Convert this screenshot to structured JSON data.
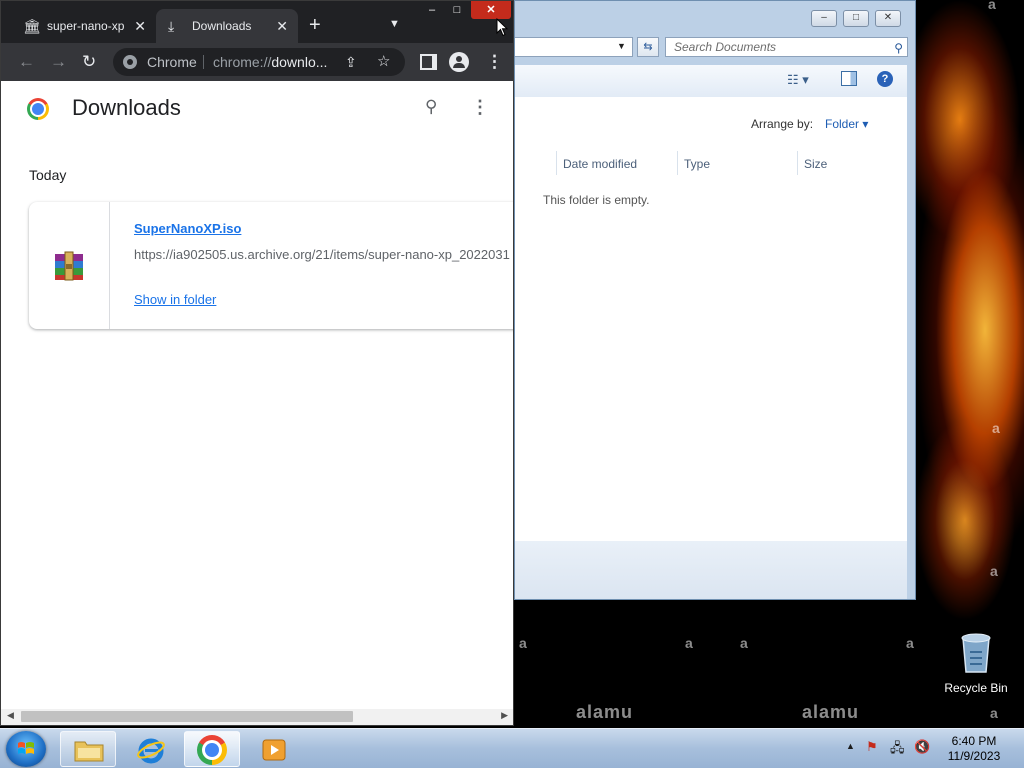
{
  "chrome": {
    "tabs": [
      {
        "label": "super-nano-xp",
        "icon": "institution-icon"
      },
      {
        "label": "Downloads",
        "icon": "download-icon"
      }
    ],
    "omnibox": {
      "site_label": "Chrome",
      "url_prefix": "chrome://",
      "url_rest": "downlo..."
    },
    "downloads": {
      "title": "Downloads",
      "section": "Today",
      "items": [
        {
          "file_name": "SuperNanoXP.iso",
          "url": "https://ia902505.us.archive.org/21/items/super-nano-xp_2022031",
          "action": "Show in folder",
          "icon": "winrar-archive-icon"
        }
      ]
    }
  },
  "explorer": {
    "search_placeholder": "Search Documents",
    "arrange_label": "Arrange by:",
    "arrange_value": "Folder",
    "columns": [
      "Date modified",
      "Type",
      "Size"
    ],
    "empty_message": "This folder is empty."
  },
  "desktop": {
    "recycle_bin_label": "Recycle Bin",
    "watermark_text": "a",
    "watermark_brand": "alamu"
  },
  "taskbar": {
    "time": "6:40 PM",
    "date": "11/9/2023"
  },
  "colors": {
    "chrome_tabstrip": "#202124",
    "chrome_toolbar": "#35363a",
    "link_blue": "#1a73e8",
    "close_red": "#c42b1c",
    "taskbar_blue": "#a7bfdc"
  }
}
